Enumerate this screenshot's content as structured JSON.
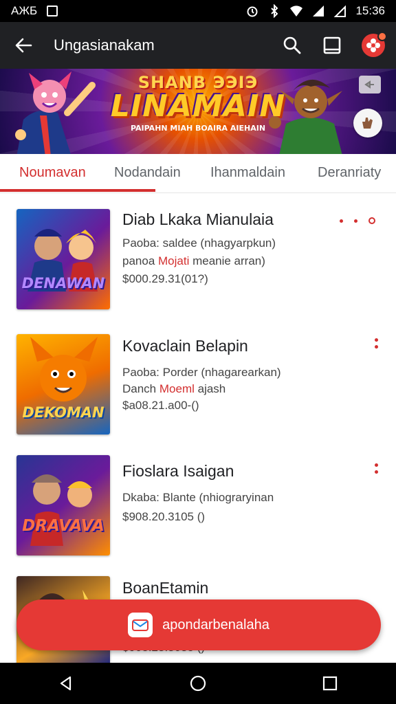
{
  "status_bar": {
    "carrier": "AЖБ",
    "time": "15:36"
  },
  "toolbar": {
    "title": "Ungasianakam"
  },
  "banner": {
    "line1": "SHANB ЭЭIЭ",
    "line2": "LINAMAIN",
    "line3": "PAIPAHN MIAH BOAIRA AIEHAIN"
  },
  "tabs": [
    {
      "label": "Noumavan",
      "active": true
    },
    {
      "label": "Nodandain",
      "active": false
    },
    {
      "label": "Ihanmaldain",
      "active": false
    },
    {
      "label": "Deranriaty",
      "active": false
    }
  ],
  "items": [
    {
      "title": "Diab Lkaka Mianulaia",
      "line1": "Paoba: saldee (nhagyarpkun)",
      "line2_pre": "panoa ",
      "line2_hl": "Mojati",
      "line2_post": " meanie arran)",
      "line3": "$000.29.31(01?)",
      "thumb_text": "DENAWAN"
    },
    {
      "title": "Kovaclain Belapin",
      "line1": "Paoba: Porder (nhagarearkan)",
      "line2_pre": "Danch ",
      "line2_hl": "Moeml",
      "line2_post": " ajash",
      "line3": "$a08.21.a00-()",
      "thumb_text": "DEKOMAN"
    },
    {
      "title": "Fioslara Isaigan",
      "line1": "Dkaba: Blante (nhiograryinan",
      "line2_pre": "",
      "line2_hl": "",
      "line2_post": "",
      "line3": "$908.20.3105 ()",
      "thumb_text": "DRAVAVA"
    },
    {
      "title": "BoanEtamin",
      "line1": "",
      "line2_pre": "",
      "line2_hl": "",
      "line2_post": "",
      "line3": "$908.23.3035 ()",
      "thumb_text": ""
    }
  ],
  "action_bar": {
    "label": "apondarbenalaha"
  },
  "colors": {
    "accent": "#d32f2f",
    "toolbar": "#202124",
    "action": "#e53935"
  }
}
